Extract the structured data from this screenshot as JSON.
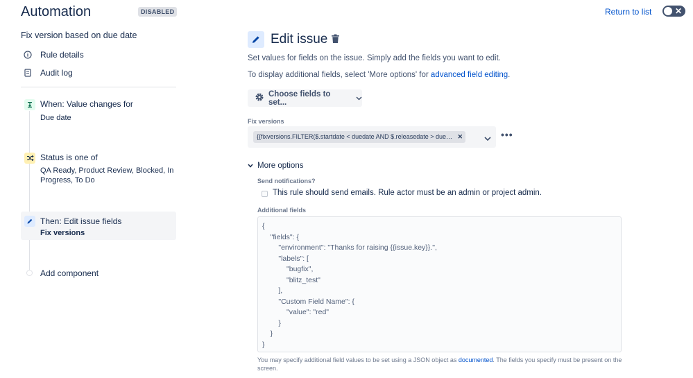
{
  "header": {
    "title": "Automation",
    "status": "DISABLED",
    "return_link": "Return to list"
  },
  "sidebar": {
    "rule_name": "Fix version based on due date",
    "links": [
      {
        "label": "Rule details",
        "icon": "info-icon"
      },
      {
        "label": "Audit log",
        "icon": "document-icon"
      }
    ],
    "steps": [
      {
        "title": "When: Value changes for",
        "subtitle": "Due date",
        "icon": "trigger-icon",
        "color": "#e3fcef"
      },
      {
        "title": "Status is one of",
        "subtitle": "QA Ready, Product Review, Blocked, In Progress, To Do",
        "icon": "shuffle-icon",
        "color": "#fff0b3"
      },
      {
        "title": "Then: Edit issue fields",
        "subtitle": "Fix versions",
        "icon": "pencil-icon",
        "color": "#deebff"
      }
    ],
    "add_component": "Add component"
  },
  "panel": {
    "title": "Edit issue",
    "desc1": "Set values for fields on the issue. Simply add the fields you want to edit.",
    "desc2_prefix": "To display additional fields, select 'More options' for ",
    "desc2_link": "advanced field editing",
    "desc2_suffix": ".",
    "choose_button": "Choose fields to set...",
    "field_label": "Fix versions",
    "fix_version_tag": "{{fixversions.FILTER($.startdate < duedate AND $.releasedate > duedate)}}",
    "more_options": "More options",
    "send_notifications_label": "Send notifications?",
    "send_notifications_text": "This rule should send emails. Rule actor must be an admin or project admin.",
    "additional_fields_label": "Additional fields",
    "json_lines": [
      "{",
      "    \"fields\": {",
      "        \"environment\": \"Thanks for raising {{issue.key}}.\",",
      "        \"labels\": [",
      "            \"bugfix\",",
      "            \"blitz_test\"",
      "        ],",
      "        \"Custom Field Name\": {",
      "            \"value\": \"red\"",
      "        }",
      "    }",
      "}"
    ],
    "help_prefix": "You may specify additional field values to be set using a JSON object as ",
    "help_link": "documented",
    "help_suffix": ". The fields you specify must be present on the screen."
  }
}
